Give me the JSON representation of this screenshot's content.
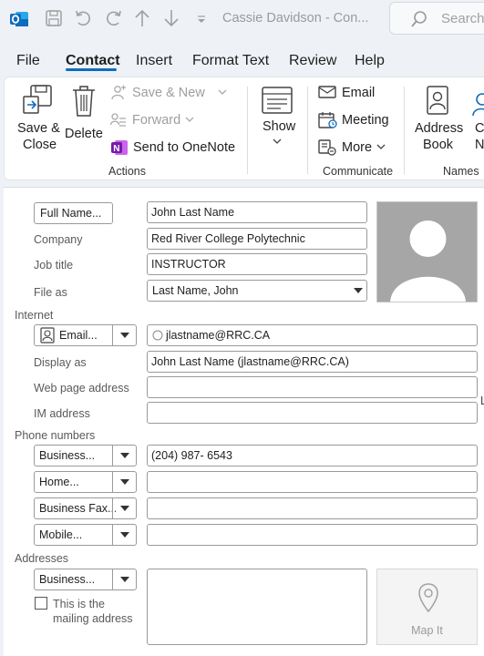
{
  "titlebar": {
    "title": "Cassie Davidson - Con...",
    "search_placeholder": "Search"
  },
  "tabs": [
    "File",
    "Contact",
    "Insert",
    "Format Text",
    "Review",
    "Help"
  ],
  "ribbon": {
    "save_close": [
      "Save &",
      "Close"
    ],
    "delete": "Delete",
    "save_new": "Save & New",
    "forward": "Forward",
    "send_onenote": "Send to OneNote",
    "actions_group": "Actions",
    "show": "Show",
    "email": "Email",
    "meeting": "Meeting",
    "more": "More",
    "communicate_group": "Communicate",
    "address_book": [
      "Address",
      "Book"
    ],
    "check_names": [
      "Ch",
      "Na"
    ],
    "names_group": "Names"
  },
  "form": {
    "full_name_button": "Full Name...",
    "full_name_value": "John Last Name",
    "company_label": "Company",
    "company_value": "Red River College Polytechnic",
    "job_title_label": "Job title",
    "job_title_value": "INSTRUCTOR",
    "file_as_label": "File as",
    "file_as_value": "Last Name, John",
    "internet_section": "Internet",
    "email_button": "Email...",
    "email_value": "jlastname@RRC.CA",
    "display_as_label": "Display as",
    "display_as_value": "John Last Name (jlastname@RRC.CA)",
    "web_page_label": "Web page address",
    "web_page_value": "",
    "im_label": "IM address",
    "im_value": "",
    "phone_section": "Phone numbers",
    "phone_business_button": "Business...",
    "phone_business_value": "(204) 987- 6543",
    "phone_home_button": "Home...",
    "phone_home_value": "",
    "phone_fax_button": "Business Fax...",
    "phone_fax_value": "",
    "phone_mobile_button": "Mobile...",
    "phone_mobile_value": "",
    "addresses_section": "Addresses",
    "address_button": "Business...",
    "address_value": "",
    "mailing_checkbox_line1": "This is the",
    "mailing_checkbox_line2": "mailing address",
    "map_it": "Map It",
    "edge_fragment": "L"
  },
  "colors": {
    "accent": "#0f6cbd",
    "onenote": "#7719aa",
    "outlook": "#0f6cbd",
    "photo_bg": "#a6a6a6"
  }
}
